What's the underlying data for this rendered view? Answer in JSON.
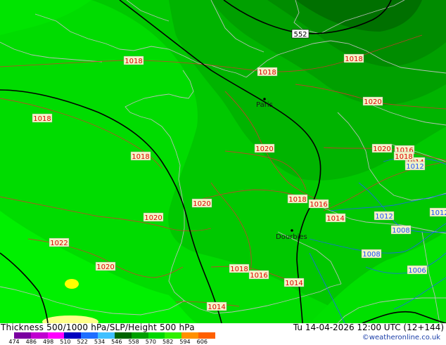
{
  "footer": {
    "title": "Thickness 500/1000 hPa/SLP/Height 500 hPa",
    "valid": "Tu 14-04-2026 12:00 UTC (12+144)",
    "credit": "©weatheronline.co.uk"
  },
  "legend": {
    "ticks": [
      "474",
      "486",
      "498",
      "510",
      "522",
      "534",
      "546",
      "558",
      "570",
      "582",
      "594",
      "606"
    ],
    "colors": [
      "#7a00a0",
      "#c000d0",
      "#ff00ff",
      "#0000c0",
      "#1e6eff",
      "#40c0ff",
      "#006400",
      "#00a000",
      "#00d800",
      "#30f000",
      "#ff9000",
      "#ff6000"
    ]
  },
  "cities": [
    {
      "name": "Paris",
      "marker": "city-dot"
    },
    {
      "name": "Dourbies",
      "marker": "city-dot"
    }
  ],
  "height_labels": [
    "552"
  ],
  "pressure_labels": [
    {
      "text": "1018",
      "color": "#e00000"
    },
    {
      "text": "1018",
      "color": "#e00000"
    },
    {
      "text": "1018",
      "color": "#e00000"
    },
    {
      "text": "1018",
      "color": "#e00000"
    },
    {
      "text": "1018",
      "color": "#e00000"
    },
    {
      "text": "1020",
      "color": "#e00000"
    },
    {
      "text": "1020",
      "color": "#e00000"
    },
    {
      "text": "1020",
      "color": "#e00000"
    },
    {
      "text": "1020",
      "color": "#e00000"
    },
    {
      "text": "1020",
      "color": "#e00000"
    },
    {
      "text": "1022",
      "color": "#e00000"
    },
    {
      "text": "1020",
      "color": "#e00000"
    },
    {
      "text": "1018",
      "color": "#e00000"
    },
    {
      "text": "1016",
      "color": "#e00000"
    },
    {
      "text": "1014",
      "color": "#e00000"
    },
    {
      "text": "1018",
      "color": "#e00000"
    },
    {
      "text": "1016",
      "color": "#e00000"
    },
    {
      "text": "1014",
      "color": "#e00000"
    },
    {
      "text": "1014",
      "color": "#e00000"
    },
    {
      "text": "1016",
      "color": "#e00000"
    },
    {
      "text": "1014",
      "color": "#e00000"
    },
    {
      "text": "1018",
      "color": "#e00000"
    },
    {
      "text": "1012",
      "color": "#1e50ff"
    },
    {
      "text": "1012",
      "color": "#1e50ff"
    },
    {
      "text": "1012",
      "color": "#1e50ff"
    },
    {
      "text": "1008",
      "color": "#1e50ff"
    },
    {
      "text": "1008",
      "color": "#1e50ff"
    },
    {
      "text": "1006",
      "color": "#1e50ff"
    }
  ]
}
